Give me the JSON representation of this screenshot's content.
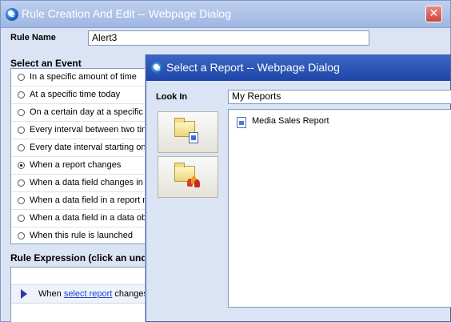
{
  "rule_dialog": {
    "title": "Rule Creation And Edit -- Webpage Dialog",
    "close_glyph": "✕",
    "rule_name_label": "Rule Name",
    "rule_name_value": "Alert3",
    "select_event_label": "Select an Event",
    "events": [
      {
        "label": "In a specific amount of time",
        "checked": false
      },
      {
        "label": "At a specific time today",
        "checked": false
      },
      {
        "label": "On a certain day at a specific t",
        "checked": false
      },
      {
        "label": "Every interval between two tin",
        "checked": false
      },
      {
        "label": "Every date interval starting on",
        "checked": false
      },
      {
        "label": "When a report changes",
        "checked": true
      },
      {
        "label": "When a data field changes in a",
        "checked": false
      },
      {
        "label": "When a data field in a report m",
        "checked": false
      },
      {
        "label": "When a data field in a data obj",
        "checked": false
      },
      {
        "label": "When this rule is launched",
        "checked": false
      }
    ],
    "rule_expression_label": "Rule Expression (click an unde",
    "expression": {
      "prefix": "When",
      "link": "select report",
      "suffix": "changes"
    }
  },
  "report_dialog": {
    "title": "Select a Report -- Webpage Dialog",
    "look_in_label": "Look In",
    "look_in_value": "My Reports",
    "places": [
      {
        "icon": "my-reports-folder-icon"
      },
      {
        "icon": "shared-reports-folder-icon"
      }
    ],
    "files": [
      {
        "name": "Media Sales Report",
        "icon": "report-file-icon"
      }
    ]
  },
  "colors": {
    "back_titlebar": "#9fb6e2",
    "front_titlebar": "#1d46a6",
    "dialog_bg": "#dbe4f4",
    "link": "#2244cc"
  }
}
